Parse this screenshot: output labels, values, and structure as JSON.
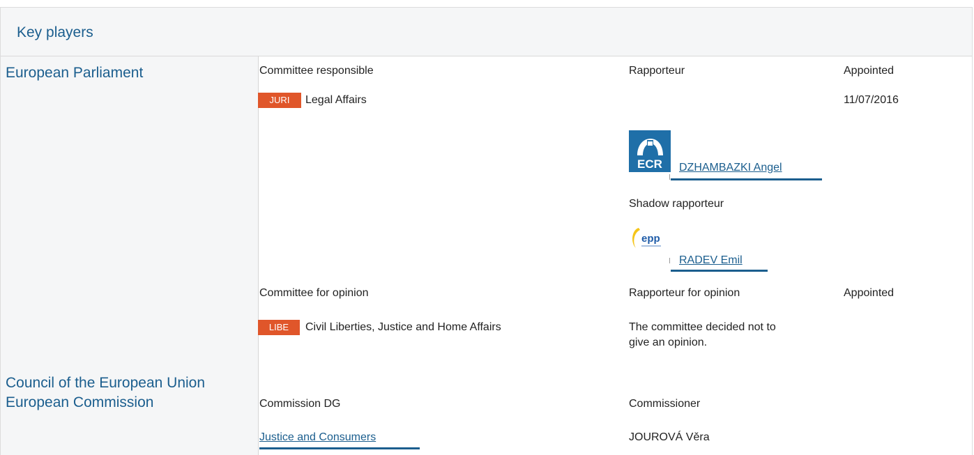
{
  "section_title": "Key players",
  "institutions": {
    "parliament": "European Parliament",
    "council": "Council of the European Union",
    "commission": "European Commission"
  },
  "responsible": {
    "heading_committee": "Committee responsible",
    "heading_rapporteur": "Rapporteur",
    "heading_appointed": "Appointed",
    "committee_code": "JURI",
    "committee_name": "Legal Affairs",
    "appointed_date": "11/07/2016",
    "rapporteur": {
      "group_logo": "ECR",
      "name": "DZHAMBAZKI Angel"
    },
    "shadow_heading": "Shadow rapporteur",
    "shadow": {
      "group_logo": "epp",
      "name": "RADEV Emil"
    }
  },
  "opinion": {
    "heading_committee": "Committee for opinion",
    "heading_rapporteur": "Rapporteur for opinion",
    "heading_appointed": "Appointed",
    "committee_code": "LIBE",
    "committee_name": "Civil Liberties, Justice and Home Affairs",
    "note_line1": "The committee decided not to",
    "note_line2": "give an opinion."
  },
  "commission": {
    "heading_dg": "Commission DG",
    "heading_commissioner": "Commissioner",
    "dg_name": "Justice and Consumers",
    "commissioner_name": "JOUROVÁ Věra"
  },
  "colors": {
    "link_blue": "#1b5e8e",
    "badge_orange": "#e0562a",
    "ecr_blue": "#1f6fa8",
    "panel_grey": "#f5f6f7"
  }
}
